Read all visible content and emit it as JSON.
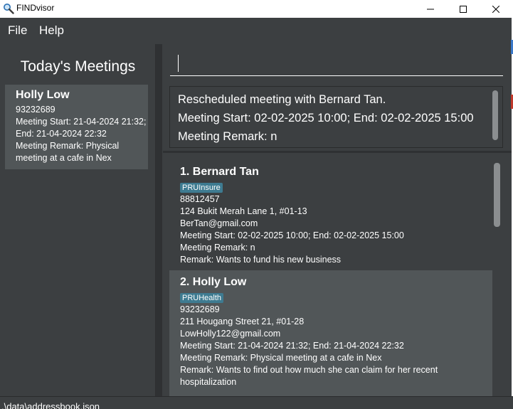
{
  "window": {
    "title": "FINDvisor",
    "app_icon": "magnifier-icon",
    "min_icon": "minimize-icon",
    "max_icon": "maximize-icon",
    "close_icon": "close-icon"
  },
  "menu": {
    "items": [
      {
        "label": "File"
      },
      {
        "label": "Help"
      }
    ]
  },
  "today_meetings": {
    "title": "Today's Meetings",
    "meetings": [
      {
        "name": "Holly Low",
        "phone": "93232689",
        "meeting": "Meeting Start: 21-04-2024 21:32; End: 21-04-2024 22:32",
        "remark": "Meeting Remark: Physical meeting at a cafe in Nex"
      }
    ]
  },
  "command": {
    "value": "",
    "placeholder": ""
  },
  "result": {
    "lines": [
      "Rescheduled meeting with Bernard Tan.",
      "Meeting Start: 02-02-2025 10:00; End: 02-02-2025 15:00",
      "Meeting Remark: n"
    ]
  },
  "persons": [
    {
      "index_name": "1.  Bernard Tan",
      "tag": "PRUInsure",
      "phone": "88812457",
      "address": "124 Bukit Merah Lane 1, #01-13",
      "email": "BerTan@gmail.com",
      "meeting": "Meeting Start: 02-02-2025 10:00; End: 02-02-2025 15:00",
      "meeting_remark": "Meeting Remark: n",
      "remark": "Remark: Wants to fund his new business"
    },
    {
      "index_name": "2.  Holly Low",
      "tag": "PRUHealth",
      "phone": "93232689",
      "address": "211 Hougang Street 21, #01-28",
      "email": "LowHolly122@gmail.com",
      "meeting": "Meeting Start: 21-04-2024 21:32; End: 21-04-2024 22:32",
      "meeting_remark": "Meeting Remark: Physical meeting at a cafe in Nex",
      "remark": "Remark: Wants to find out how much she can claim for her recent hospitalization"
    }
  ],
  "status": {
    "path": ".\\data\\addressbook.json"
  },
  "colors": {
    "background": "#3c3f41",
    "card_selected": "#515658",
    "tag": "#3e7b91"
  }
}
